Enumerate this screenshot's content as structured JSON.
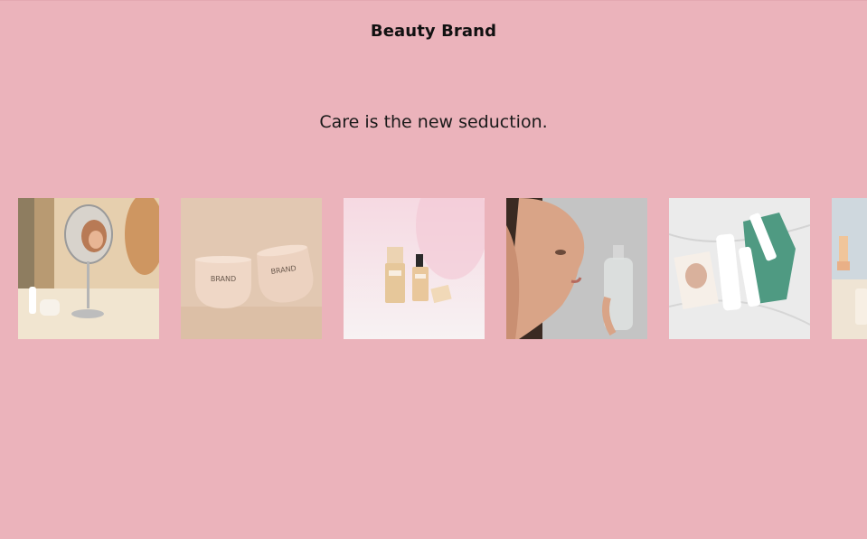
{
  "header": {
    "brand": "Beauty Brand"
  },
  "hero": {
    "tagline": "Care is the new seduction."
  },
  "gallery": {
    "items": [
      {
        "name": "woman-with-mirror-photo",
        "label": ""
      },
      {
        "name": "brand-cream-jars-photo",
        "label": "BRAND"
      },
      {
        "name": "foundation-bottles-photo",
        "label": ""
      },
      {
        "name": "woman-skincare-face-photo",
        "label": ""
      },
      {
        "name": "skincare-products-flatlay-photo",
        "label": ""
      },
      {
        "name": "product-display-photo",
        "label": ""
      }
    ]
  },
  "colors": {
    "background": "#ebb3bb",
    "text": "#111111"
  }
}
